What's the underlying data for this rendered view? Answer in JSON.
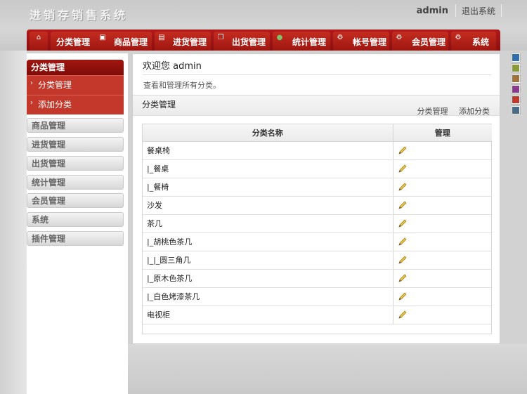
{
  "header": {
    "app_title": "进销存销售系统",
    "user_name": "admin",
    "logout_label": "退出系统"
  },
  "nav": {
    "tabs": [
      {
        "label": "分类管理",
        "icon": "none"
      },
      {
        "label": "商品管理",
        "icon": "window-icon"
      },
      {
        "label": "进货管理",
        "icon": "document-icon"
      },
      {
        "label": "出货管理",
        "icon": "copy-icon"
      },
      {
        "label": "统计管理",
        "icon": "globe-icon"
      },
      {
        "label": "帐号管理",
        "icon": "gear-icon"
      },
      {
        "label": "会员管理",
        "icon": "gear-icon"
      },
      {
        "label": "系统",
        "icon": "gear-icon"
      }
    ]
  },
  "swatches": [
    "#2f6fb0",
    "#8a9a3a",
    "#a0733e",
    "#8a3a8a",
    "#c0392b",
    "#4a6a8a"
  ],
  "sidebar": {
    "active_group": {
      "title": "分类管理",
      "items": [
        "分类管理",
        "添加分类"
      ]
    },
    "groups": [
      "商品管理",
      "进货管理",
      "出货管理",
      "统计管理",
      "会员管理",
      "系统",
      "插件管理"
    ]
  },
  "main": {
    "welcome": "欢迎您 admin",
    "description": "查看和管理所有分类。",
    "panel": {
      "title": "分类管理",
      "links": [
        "分类管理",
        "添加分类"
      ],
      "columns": [
        "分类名称",
        "管理"
      ],
      "rows": [
        "餐桌椅",
        "|_餐桌",
        "|_餐椅",
        "沙发",
        "茶几",
        "|_胡桃色茶几",
        "|_|_圆三角几",
        "|_原木色茶几",
        "|_白色烤漆茶几",
        "电视柜"
      ]
    }
  },
  "colors": {
    "nav_red": "#a3150f",
    "sidebar_active": "#c0392b",
    "pencil": "#c8a020"
  }
}
